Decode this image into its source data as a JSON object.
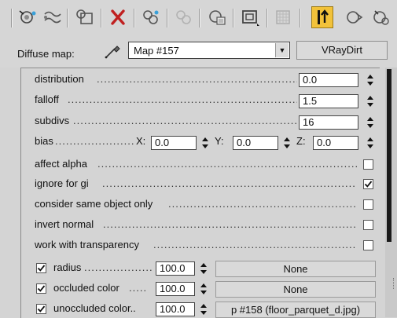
{
  "toolbar": {
    "icons": [
      "sample-type-sphere-icon",
      "put-to-library-icon",
      "assign-material-icon",
      "delete-icon",
      "make-unique-icon",
      "put-to-library-disabled-icon",
      "material-effects-channel-icon",
      "show-in-viewport-icon",
      "show-end-result-icon",
      "go-to-parent-icon",
      "go-forward-sibling-icon",
      "pick-material-icon"
    ],
    "active_color": "#f2c23a"
  },
  "map": {
    "label": "Diffuse map:",
    "value": "Map #157",
    "type_button": "VRayDirt"
  },
  "params": {
    "distribution": {
      "label": "distribution",
      "value": "0.0"
    },
    "falloff": {
      "label": "falloff",
      "value": "1.5"
    },
    "subdivs": {
      "label": "subdivs",
      "value": "16"
    },
    "bias": {
      "label": "bias",
      "x_label": "X:",
      "x_value": "0.0",
      "y_label": "Y:",
      "y_value": "0.0",
      "z_label": "Z:",
      "z_value": "0.0"
    },
    "affect_alpha": {
      "label": "affect alpha",
      "checked": false
    },
    "ignore_for_gi": {
      "label": "ignore for gi",
      "checked": true
    },
    "consider_same_object_only": {
      "label": "consider same object only",
      "checked": false
    },
    "invert_normal": {
      "label": "invert normal",
      "checked": false
    },
    "work_with_transparency": {
      "label": "work with transparency",
      "checked": false
    },
    "radius": {
      "label": "radius",
      "checked": true,
      "amount": "100.0",
      "map": "None"
    },
    "occluded_color": {
      "label": "occluded color",
      "checked": true,
      "amount": "100.0",
      "map": "None"
    },
    "unoccluded_color": {
      "label": "unoccluded color..",
      "checked": true,
      "amount": "100.0",
      "map": "p #158 (floor_parquet_d.jpg)"
    }
  }
}
